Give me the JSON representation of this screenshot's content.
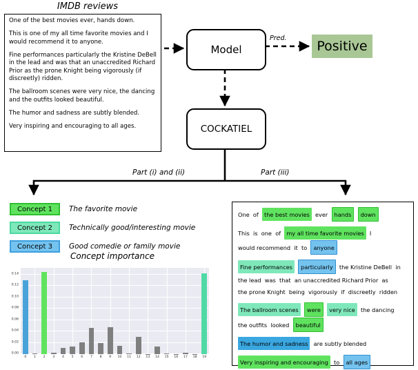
{
  "figure": {
    "imdb": {
      "title": "IMDB reviews",
      "paragraphs": [
        "One of the best movies ever, hands down.",
        "This is one of my all time favorite movies and I would recommend it to anyone.",
        "Fine performances particularly the Kristine DeBell in the lead and was that an unaccredited Richard Prior as the prone Knight being vigorously (if discreetly) ridden.",
        "The ballroom scenes were very nice, the dancing and the outfits looked beautiful.",
        "The humor and sadness are subtly blended.",
        "Very inspiring and encouraging to all ages."
      ]
    },
    "flow": {
      "model_label": "Model",
      "cockatiel_label": "COCKATIEL",
      "pred_label": "Pred.",
      "prediction_value": "Positive",
      "prediction_color": "#a9c795",
      "branch_left_label": "Part (i) and (ii)",
      "branch_right_label": "Part (iii)"
    },
    "legend": {
      "items": [
        {
          "chip": "Concept 1",
          "description": "The favorite movie",
          "fill": "#5fe35f",
          "border": "#2fbf2f"
        },
        {
          "chip": "Concept 2",
          "description": "Technically good/interesting movie",
          "fill": "#7fe8bb",
          "border": "#49d9a0"
        },
        {
          "chip": "Concept 3",
          "description": "Good comedie or family movie",
          "fill": "#74c3ef",
          "border": "#3d9ede"
        }
      ]
    },
    "text_panel": {
      "paragraphs": [
        {
          "lines": [
            [
              {
                "t": "One",
                "h": "none"
              },
              {
                "t": "of",
                "h": "none"
              },
              {
                "t": "the best movies",
                "h": "c1"
              },
              {
                "t": "ever",
                "h": "none"
              },
              {
                "t": "hands",
                "h": "c1box"
              },
              {
                "t": "down",
                "h": "c1box"
              }
            ]
          ]
        },
        {
          "lines": [
            [
              {
                "t": "This",
                "h": "none"
              },
              {
                "t": "is",
                "h": "none"
              },
              {
                "t": "one",
                "h": "none"
              },
              {
                "t": "of",
                "h": "none"
              },
              {
                "t": "my all time favorite movies",
                "h": "c1"
              },
              {
                "t": "I",
                "h": "none"
              }
            ],
            [
              {
                "t": "would recommend",
                "h": "none"
              },
              {
                "t": "it",
                "h": "none"
              },
              {
                "t": "to",
                "h": "none"
              },
              {
                "t": "anyone",
                "h": "c3box"
              }
            ]
          ]
        },
        {
          "lines": [
            [
              {
                "t": "Fine performances",
                "h": "c2"
              },
              {
                "t": "particularly",
                "h": "c3box"
              },
              {
                "t": "the Kristine DeBell",
                "h": "none"
              },
              {
                "t": "in",
                "h": "none"
              }
            ],
            [
              {
                "t": "the lead",
                "h": "none"
              },
              {
                "t": "was",
                "h": "none"
              },
              {
                "t": "that",
                "h": "none"
              },
              {
                "t": "an unaccredited Richard Prior",
                "h": "none"
              },
              {
                "t": "as",
                "h": "none"
              }
            ],
            [
              {
                "t": "the prone Knight",
                "h": "none"
              },
              {
                "t": "being",
                "h": "none"
              },
              {
                "t": "vigorously",
                "h": "none"
              },
              {
                "t": "if",
                "h": "none"
              },
              {
                "t": "discreetly",
                "h": "none"
              },
              {
                "t": "ridden",
                "h": "none"
              }
            ]
          ]
        },
        {
          "lines": [
            [
              {
                "t": "The ballroom scenes",
                "h": "c2"
              },
              {
                "t": "were",
                "h": "c1box"
              },
              {
                "t": "very nice",
                "h": "c2"
              },
              {
                "t": "the dancing",
                "h": "none"
              }
            ],
            [
              {
                "t": "the outfits",
                "h": "none"
              },
              {
                "t": "looked",
                "h": "none"
              },
              {
                "t": "beautiful",
                "h": "c1box"
              }
            ]
          ]
        },
        {
          "lines": [
            [
              {
                "t": "The humor and sadness",
                "h": "c3solid"
              },
              {
                "t": "are subtly blended",
                "h": "none"
              }
            ]
          ]
        },
        {
          "lines": [
            [
              {
                "t": "Very inspiring and encouraging",
                "h": "c1"
              },
              {
                "t": "to",
                "h": "none"
              },
              {
                "t": "all ages",
                "h": "c3box"
              }
            ]
          ]
        }
      ]
    },
    "chart_data": {
      "type": "bar",
      "title": "Concept importance",
      "xlabel": "",
      "ylabel": "",
      "categories": [
        "0",
        "1",
        "2",
        "3",
        "4",
        "5",
        "6",
        "7",
        "8",
        "9",
        "10",
        "11",
        "12",
        "13",
        "14",
        "15",
        "16",
        "17",
        "18",
        "19"
      ],
      "values": [
        0.13,
        0.001,
        0.145,
        0.003,
        0.011,
        0.013,
        0.021,
        0.046,
        0.02,
        0.047,
        0.015,
        0.001,
        0.03,
        0.0,
        0.013,
        0.001,
        0.0,
        0.002,
        0.0,
        0.142
      ],
      "bar_colors": [
        "#4aa3d8",
        "#7f7f7f",
        "#5fe35f",
        "#7f7f7f",
        "#7f7f7f",
        "#7f7f7f",
        "#7f7f7f",
        "#7f7f7f",
        "#7f7f7f",
        "#7f7f7f",
        "#7f7f7f",
        "#7f7f7f",
        "#7f7f7f",
        "#7f7f7f",
        "#7f7f7f",
        "#7f7f7f",
        "#7f7f7f",
        "#7f7f7f",
        "#7f7f7f",
        "#4fd9a5"
      ],
      "ylim": [
        0.0,
        0.152
      ],
      "yticks": [
        0.0,
        0.02,
        0.04,
        0.06,
        0.08,
        0.1,
        0.12,
        0.14
      ],
      "ytick_labels": [
        "0.00",
        "0.02",
        "0.04",
        "0.06",
        "0.08",
        "0.10",
        "0.12",
        "0.14"
      ],
      "grid": true,
      "legend": "none",
      "plot_background": "#eaeaf2"
    }
  }
}
